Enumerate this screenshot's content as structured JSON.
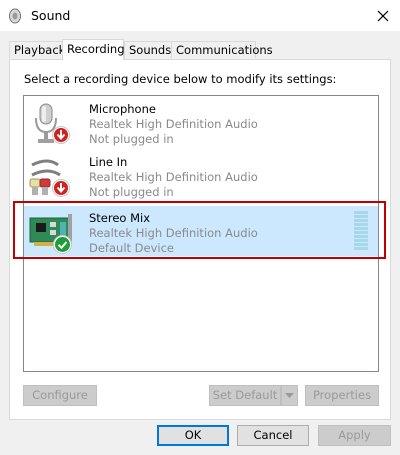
{
  "window": {
    "title": "Sound"
  },
  "tabs": [
    {
      "label": "Playback"
    },
    {
      "label": "Recording"
    },
    {
      "label": "Sounds"
    },
    {
      "label": "Communications"
    }
  ],
  "instruction": "Select a recording device below to modify its settings:",
  "devices": [
    {
      "name": "Microphone",
      "driver": "Realtek High Definition Audio",
      "status": "Not plugged in",
      "icon": "microphone-icon"
    },
    {
      "name": "Line In",
      "driver": "Realtek High Definition Audio",
      "status": "Not plugged in",
      "icon": "line-in-icon"
    },
    {
      "name": "Stereo Mix",
      "driver": "Realtek High Definition Audio",
      "status": "Default Device",
      "icon": "sound-card-icon",
      "selected": true,
      "level": 0
    }
  ],
  "buttons": {
    "configure": "Configure",
    "set_default": "Set Default",
    "properties": "Properties",
    "ok": "OK",
    "cancel": "Cancel",
    "apply": "Apply"
  },
  "colors": {
    "selection": "#cce8ff",
    "highlight_frame": "#c00000",
    "default_button": "#0078d7",
    "status_red": "#d21f1f",
    "status_green": "#1e9e3a"
  }
}
